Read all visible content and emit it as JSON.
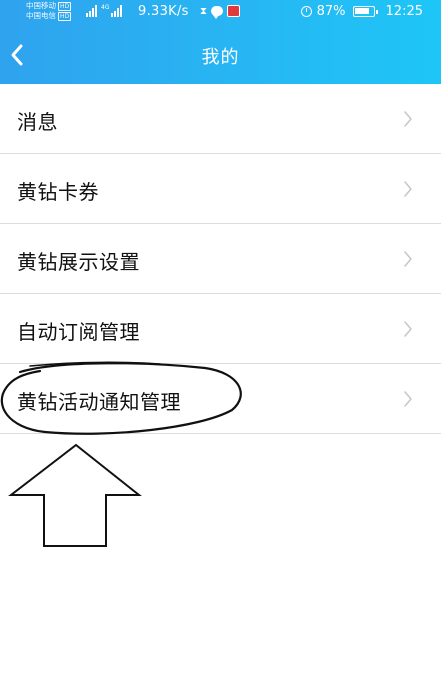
{
  "status_bar": {
    "carrier_1": "中国移动",
    "carrier_2": "中国电信",
    "hd_badge": "HD",
    "signal_label": "4G",
    "net_speed": "9.33K/s",
    "battery_percent": "87%",
    "time": "12:25"
  },
  "header": {
    "title": "我的"
  },
  "menu": {
    "items": [
      {
        "label": "消息"
      },
      {
        "label": "黄钻卡券"
      },
      {
        "label": "黄钻展示设置"
      },
      {
        "label": "自动订阅管理"
      },
      {
        "label": "黄钻活动通知管理"
      }
    ]
  },
  "colors": {
    "header_start": "#2fa3ee",
    "header_end": "#1ec6f7",
    "divider": "#dcdcdc",
    "chevron": "#c8c8c8"
  }
}
